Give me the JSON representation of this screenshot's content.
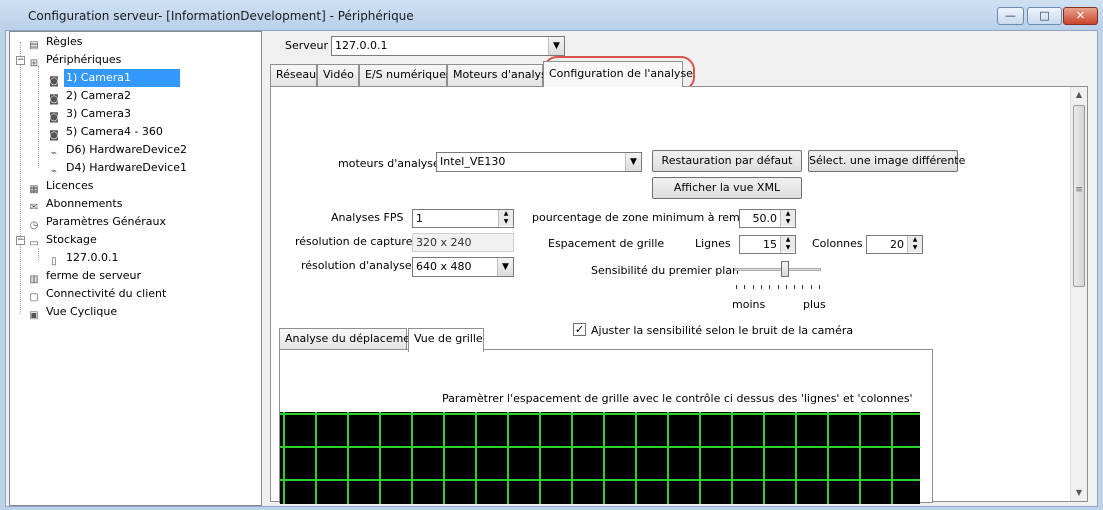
{
  "window": {
    "title": "Configuration serveur- [InformationDevelopment] - Périphérique",
    "minimize_glyph": "—",
    "maximize_glyph": "□",
    "close_glyph": "✕"
  },
  "tree": {
    "items": [
      {
        "label": "Règles",
        "icon": "rules-icon"
      },
      {
        "label": "Périphériques",
        "icon": "devices-icon"
      },
      {
        "label": "1) Camera1",
        "icon": "camera-icon"
      },
      {
        "label": "2) Camera2",
        "icon": "camera-icon"
      },
      {
        "label": "3) Camera3",
        "icon": "camera-icon"
      },
      {
        "label": "5) Camera4 - 360",
        "icon": "camera-icon"
      },
      {
        "label": "D6) HardwareDevice2",
        "icon": "hardware-device-icon"
      },
      {
        "label": "D4) HardwareDevice1",
        "icon": "hardware-device-icon"
      },
      {
        "label": "Licences",
        "icon": "licence-icon"
      },
      {
        "label": "Abonnements",
        "icon": "subscription-icon"
      },
      {
        "label": "Paramètres Généraux",
        "icon": "general-settings-icon"
      },
      {
        "label": "Stockage",
        "icon": "storage-icon"
      },
      {
        "label": "127.0.0.1",
        "icon": "storage-server-icon"
      },
      {
        "label": "ferme de serveur",
        "icon": "server-farm-icon"
      },
      {
        "label": "Connectivité du client",
        "icon": "client-connectivity-icon"
      },
      {
        "label": "Vue Cyclique",
        "icon": "cyclic-view-icon"
      }
    ],
    "expand_glyph_open": "−"
  },
  "server": {
    "label": "Serveur",
    "value": "127.0.0.1"
  },
  "tabs": [
    {
      "label": "Réseau"
    },
    {
      "label": "Vidéo"
    },
    {
      "label": "E/S numériques"
    },
    {
      "label": "Moteurs d'analyse"
    },
    {
      "label": "Configuration de l'analyse"
    }
  ],
  "analysis": {
    "engine_label": "moteurs d'analyse",
    "engine_value": "Intel_VE130",
    "restore_default_button": "Restauration par défaut",
    "select_image_button": "Sélect. une image différente",
    "show_xml_button": "Afficher la vue XML",
    "fps_label": "Analyses FPS",
    "fps_value": "1",
    "capture_res_label": "résolution de capture",
    "capture_res_value": "320 x 240",
    "analysis_res_label": "résolution d'analyse",
    "analysis_res_value": "640 x 480",
    "min_zone_label": "pourcentage de zone minimum à rempl",
    "min_zone_value": "50.0",
    "grid_spacing_label": "Espacement de grille",
    "rows_label": "Lignes",
    "rows_value": "15",
    "cols_label": "Colonnes",
    "cols_value": "20",
    "foreground_label": "Sensibilité du premier plan",
    "less_label": "moins",
    "more_label": "plus",
    "sensitivity_level": 0.6,
    "noise_checkbox_label": "Ajuster la sensibilité selon le bruit de la caméra",
    "noise_checkbox_checked": true,
    "check_glyph": "✓"
  },
  "subtabs": [
    {
      "label": "Analyse du déplacement"
    },
    {
      "label": "Vue de grille"
    }
  ],
  "grid_view": {
    "instruction": "Paramètrer l'espacement de grille avec le contrôle ci dessus des 'lignes' et 'colonnes'",
    "line_color": "#2bd12b",
    "background": "#000000"
  },
  "glyphs": {
    "dropdown": "▼",
    "spin_up": "▲",
    "spin_down": "▼",
    "scroll_up": "▲",
    "scroll_down": "▼",
    "scroll_grip": "≡"
  }
}
